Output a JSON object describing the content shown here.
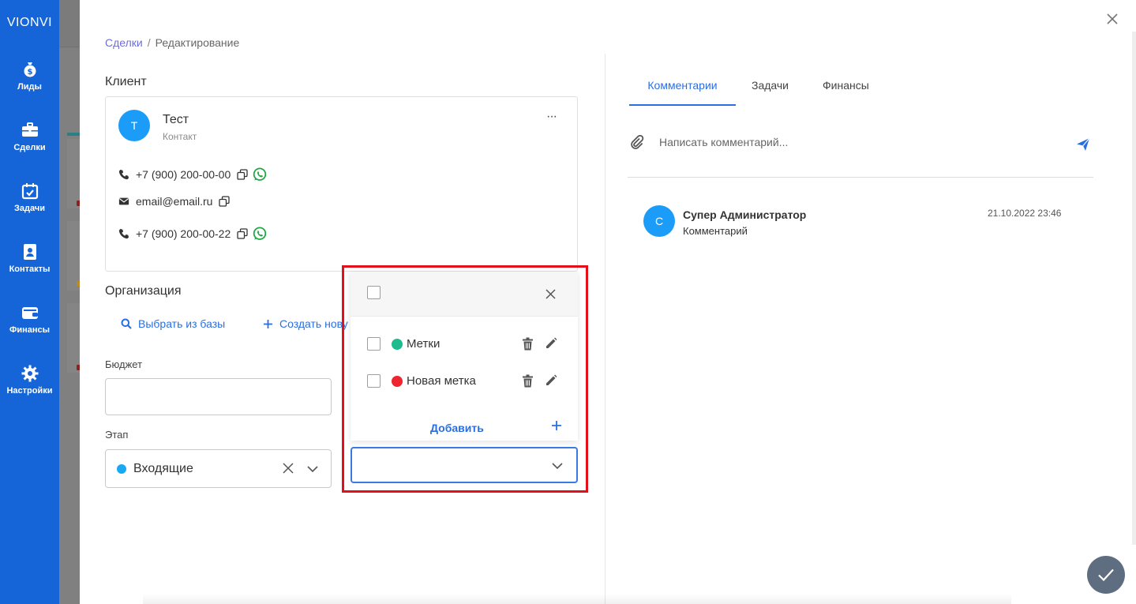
{
  "app": {
    "brand": "VIONVI"
  },
  "sidebar": {
    "items": [
      {
        "label": "Лиды",
        "icon": "dollar-bag-icon"
      },
      {
        "label": "Сделки",
        "icon": "briefcase-icon"
      },
      {
        "label": "Задачи",
        "icon": "calendar-check-icon"
      },
      {
        "label": "Контакты",
        "icon": "contact-book-icon"
      },
      {
        "label": "Финансы",
        "icon": "wallet-icon"
      },
      {
        "label": "Настройки",
        "icon": "gear-icon"
      }
    ]
  },
  "breadcrumb": {
    "parent": "Сделки",
    "separator": "/",
    "current": "Редактирование"
  },
  "client": {
    "section_title": "Клиент",
    "avatar_letter": "Т",
    "name": "Тест",
    "type": "Контакт",
    "more": "···",
    "phone1": "+7 (900) 200-00-00",
    "email": "email@email.ru",
    "phone2": "+7 (900) 200-00-22"
  },
  "organization": {
    "section_title": "Организация",
    "pick_label": "Выбрать из базы",
    "create_label": "Создать нову"
  },
  "budget": {
    "label": "Бюджет",
    "value": ""
  },
  "stage": {
    "label": "Этап",
    "value": "Входящие",
    "color": "#19a9f0"
  },
  "tags": {
    "items": [
      {
        "name": "Метки",
        "color": "#1dbb8d"
      },
      {
        "name": "Новая метка",
        "color": "#ee2430"
      }
    ],
    "add_label": "Добавить",
    "value": ""
  },
  "tabs": [
    {
      "label": "Комментарии",
      "active": true
    },
    {
      "label": "Задачи",
      "active": false
    },
    {
      "label": "Финансы",
      "active": false
    }
  ],
  "comment_input": {
    "placeholder": "Написать комментарий..."
  },
  "comments": [
    {
      "avatar_letter": "С",
      "author": "Супер Администратор",
      "text": "Комментарий",
      "time": "21.10.2022 23:46"
    }
  ],
  "colors": {
    "sidebar": "#1565d8",
    "accent": "#2a6fe0",
    "highlight": "#e3101c",
    "fab": "#5e6e80"
  }
}
